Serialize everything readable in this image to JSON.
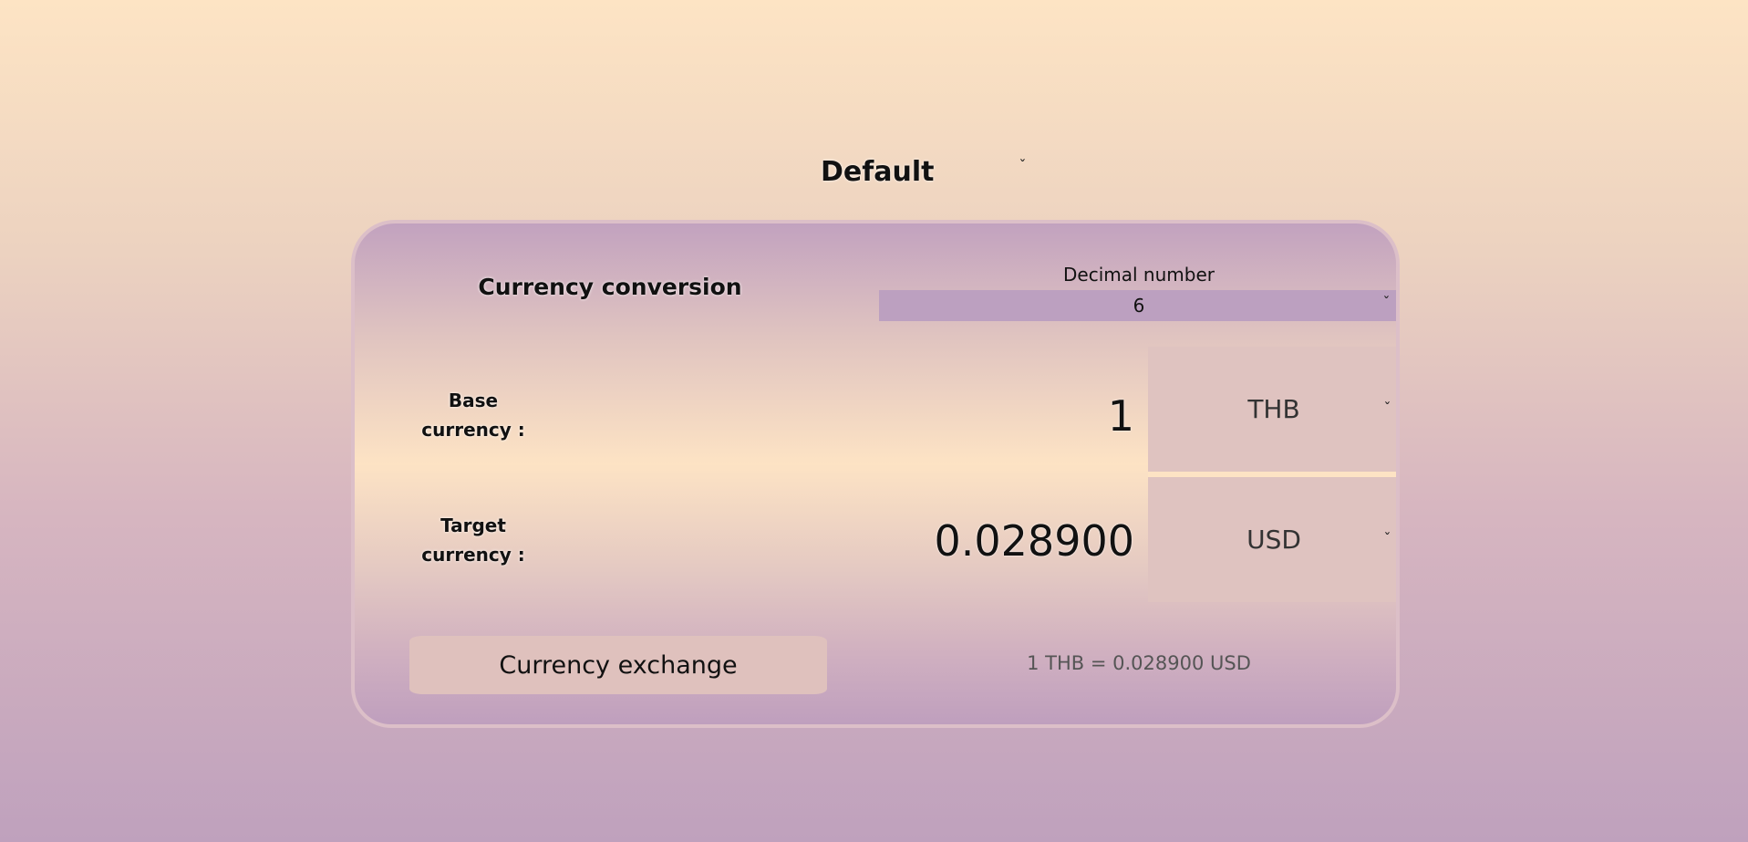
{
  "theme": {
    "selected": "Default"
  },
  "card": {
    "title": "Currency conversion",
    "decimal": {
      "label": "Decimal number",
      "selected": "6"
    },
    "base": {
      "label_line1": "Base",
      "label_line2": "currency :",
      "amount": "1",
      "currency": "THB"
    },
    "target": {
      "label_line1": "Target",
      "label_line2": "currency :",
      "amount": "0.028900",
      "currency": "USD"
    },
    "exchange_button": "Currency exchange",
    "rate_text": "1 THB = 0.028900 USD"
  },
  "icons": {
    "dropdown": "chevron-down-icon"
  },
  "colors": {
    "card_header": "#c2a2bf",
    "decimal_select_bg": "#bca0c0",
    "currency_select_bg": "#dfc3c0",
    "divider": "#fde3c4",
    "button_bg": "#dfc1bd",
    "rate_text": "#555555"
  }
}
